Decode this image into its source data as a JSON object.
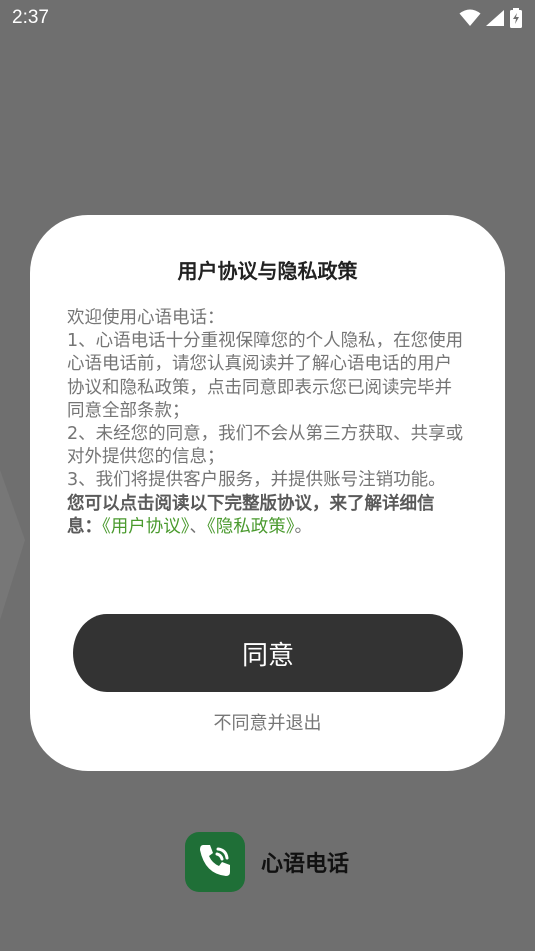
{
  "status_bar": {
    "time": "2:37"
  },
  "dialog": {
    "title": "用户协议与隐私政策",
    "greeting": "欢迎使用心语电话：",
    "item1": " 1、心语电话十分重视保障您的个人隐私，在您使用心语电话前，请您认真阅读并了解心语电话的用户协议和隐私政策，点击同意即表示您已阅读完毕并同意全部条款；",
    "item2": " 2、未经您的同意，我们不会从第三方获取、共享或对外提供您的信息；",
    "item3": " 3、我们将提供客户服务，并提供账号注销功能。",
    "emphasis_text": " 您可以点击阅读以下完整版协议，来了解详细信息：",
    "link_user_agreement": "《用户协议》",
    "separator": "、",
    "link_privacy_policy": "《隐私政策》",
    "end_punct": "。",
    "agree_label": "同意",
    "decline_label": "不同意并退出"
  },
  "brand": {
    "app_name": "心语电话"
  },
  "colors": {
    "overlay": "#6f6f6f",
    "link_green": "#4a9a2e",
    "button_dark": "#333333",
    "logo_green": "#1f6f37"
  },
  "icons": {
    "wifi": "wifi-icon",
    "signal": "signal-icon",
    "battery": "battery-charging-icon",
    "logo": "phone-icon"
  }
}
